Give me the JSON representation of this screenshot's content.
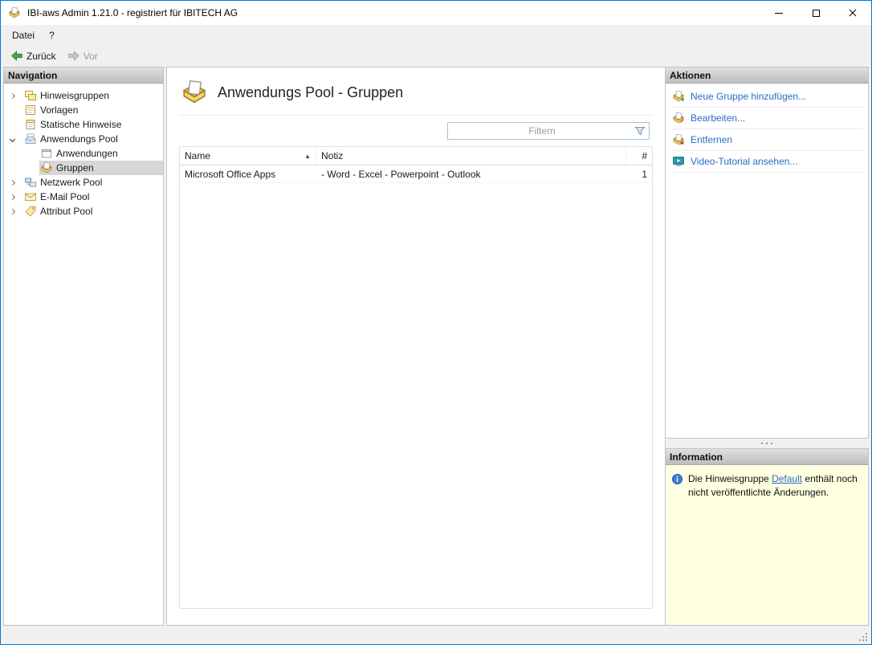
{
  "colors": {
    "accent_border": "#0078d7",
    "link_blue": "#2b6cc4",
    "info_background": "#ffffe1",
    "selection_gray": "#d6d6d6"
  },
  "window": {
    "title": "IBI-aws Admin 1.21.0 - registriert für IBITECH AG"
  },
  "menu": {
    "items": [
      {
        "label": "Datei"
      },
      {
        "label": "?"
      }
    ]
  },
  "toolbar": {
    "back": "Zurück",
    "forward": "Vor"
  },
  "navigation": {
    "header": "Navigation",
    "items": [
      {
        "label": "Hinweisgruppen"
      },
      {
        "label": "Vorlagen"
      },
      {
        "label": "Statische Hinweise"
      },
      {
        "label": "Anwendungs Pool"
      },
      {
        "label": "Anwendungen"
      },
      {
        "label": "Gruppen"
      },
      {
        "label": "Netzwerk Pool"
      },
      {
        "label": "E-Mail Pool"
      },
      {
        "label": "Attribut Pool"
      }
    ]
  },
  "main": {
    "title": "Anwendungs Pool - Gruppen",
    "filter_placeholder": "Filtern",
    "table": {
      "columns": {
        "name": "Name",
        "notiz": "Notiz",
        "count": "#"
      },
      "sort_icon": "▲",
      "rows": [
        {
          "name": "Microsoft Office Apps",
          "notiz": "- Word - Excel - Powerpoint - Outlook",
          "count": "1"
        }
      ]
    }
  },
  "actions": {
    "header": "Aktionen",
    "items": [
      {
        "label": "Neue Gruppe hinzufügen..."
      },
      {
        "label": "Bearbeiten..."
      },
      {
        "label": "Entfernen"
      },
      {
        "label": "Video-Tutorial ansehen..."
      }
    ]
  },
  "information": {
    "header": "Information",
    "text_before": "Die Hinweisgruppe ",
    "link_text": "Default",
    "text_after": " enthält noch nicht veröffentlichte Änderungen."
  }
}
